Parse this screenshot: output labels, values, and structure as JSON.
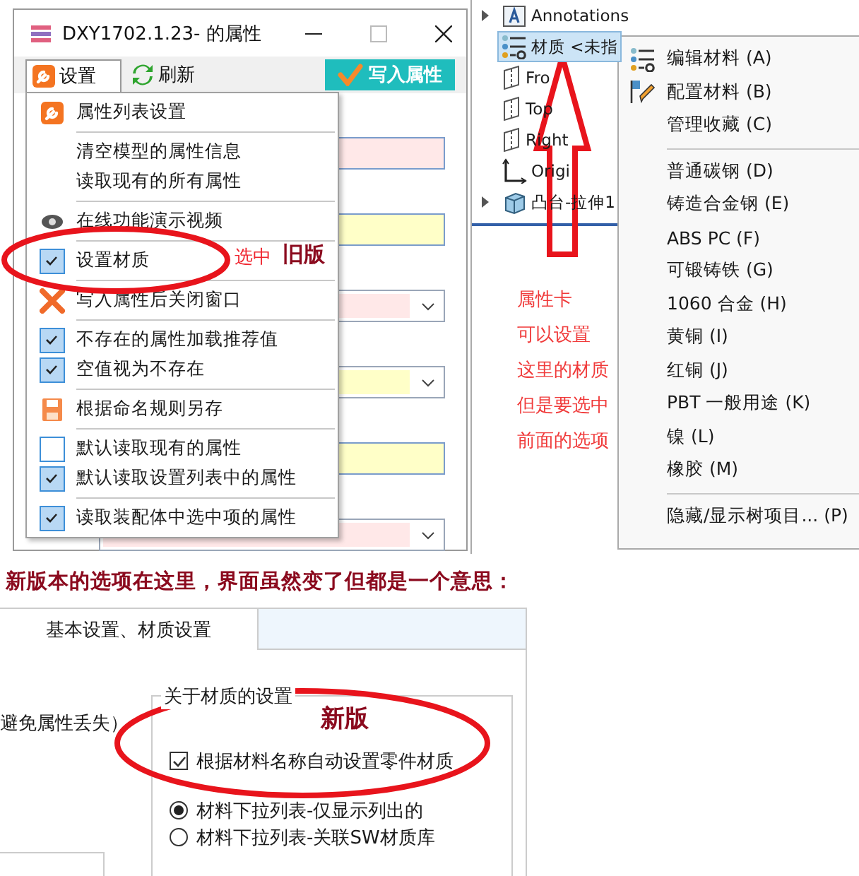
{
  "properties_window": {
    "title": "DXY1702.1.23-  的属性",
    "toolbar": [
      {
        "label": "设置",
        "kind": "settings",
        "selected": true
      },
      {
        "label": "刷新",
        "kind": "refresh",
        "selected": false
      },
      {
        "label": "写入属性",
        "kind": "write",
        "selected": false
      }
    ],
    "fields": [
      {
        "kind": "input",
        "color": "#ffe8e8"
      },
      {
        "kind": "input",
        "color": "#ffffc8"
      },
      {
        "kind": "select",
        "color": "#ffe8e8"
      },
      {
        "kind": "select",
        "color": "#ffffc8"
      },
      {
        "kind": "input",
        "color": "#ffffc8"
      },
      {
        "kind": "select",
        "color": "#ffe8e8"
      }
    ],
    "settings_menu": [
      {
        "kind": "settings",
        "label": "属性列表设置"
      },
      {
        "kind": "separator"
      },
      {
        "kind": "plain",
        "label": "清空模型的属性信息"
      },
      {
        "kind": "plain",
        "label": "读取现有的所有属性"
      },
      {
        "kind": "separator"
      },
      {
        "kind": "demo",
        "label": "在线功能演示视频"
      },
      {
        "kind": "separator"
      },
      {
        "kind": "check",
        "label": "设置材质",
        "checked": true
      },
      {
        "kind": "separator"
      },
      {
        "kind": "close",
        "label": "写入属性后关闭窗口"
      },
      {
        "kind": "separator"
      },
      {
        "kind": "check",
        "label": "不存在的属性加载推荐值",
        "checked": true
      },
      {
        "kind": "check",
        "label": "空值视为不存在",
        "checked": true
      },
      {
        "kind": "separator"
      },
      {
        "kind": "save",
        "label": "根据命名规则另存"
      },
      {
        "kind": "separator"
      },
      {
        "kind": "check",
        "label": "默认读取现有的属性",
        "checked": false
      },
      {
        "kind": "check",
        "label": "默认读取设置列表中的属性",
        "checked": true
      },
      {
        "kind": "separator"
      },
      {
        "kind": "check",
        "label": "读取装配体中选中项的属性",
        "checked": true
      }
    ]
  },
  "feature_tree": {
    "items": [
      {
        "kind": "annotations",
        "label": "Annotations",
        "expandable": true,
        "selected": false
      },
      {
        "kind": "material",
        "label": "材质 <未指",
        "expandable": false,
        "selected": true
      },
      {
        "kind": "plane",
        "label": "Fro",
        "expandable": false,
        "selected": false
      },
      {
        "kind": "plane",
        "label": "Top",
        "expandable": false,
        "selected": false
      },
      {
        "kind": "plane",
        "label": "Right",
        "expandable": false,
        "selected": false
      },
      {
        "kind": "origin",
        "label": "Origi",
        "expandable": false,
        "selected": false
      },
      {
        "kind": "feature",
        "label": "凸台-拉伸1",
        "expandable": true,
        "selected": false
      }
    ],
    "context_menu": [
      {
        "kind": "edit",
        "label": "编辑材料 (A)"
      },
      {
        "kind": "config",
        "label": "配置材料 (B)"
      },
      {
        "kind": "plain",
        "label": "管理收藏 (C)"
      },
      {
        "kind": "separator"
      },
      {
        "kind": "plain",
        "label": "普通碳钢 (D)"
      },
      {
        "kind": "plain",
        "label": "铸造合金钢 (E)"
      },
      {
        "kind": "plain",
        "label": "ABS PC (F)"
      },
      {
        "kind": "plain",
        "label": "可锻铸铁 (G)"
      },
      {
        "kind": "plain",
        "label": "1060 合金 (H)"
      },
      {
        "kind": "plain",
        "label": "黄铜 (I)"
      },
      {
        "kind": "plain",
        "label": "红铜 (J)"
      },
      {
        "kind": "plain",
        "label": "PBT 一般用途 (K)"
      },
      {
        "kind": "plain",
        "label": "镍 (L)"
      },
      {
        "kind": "plain",
        "label": "橡胶 (M)"
      },
      {
        "kind": "separator"
      },
      {
        "kind": "plain",
        "label": "隐藏/显示树项目... (P)"
      }
    ]
  },
  "new_settings_panel": {
    "tabs": [
      {
        "label": "基本设置、材质设置",
        "selected": true
      }
    ],
    "side_text": "避免属性丢失）",
    "group_title": "关于材质的设置",
    "options": [
      {
        "kind": "checkbox",
        "label": "根据材料名称自动设置零件材质",
        "checked": true
      },
      {
        "kind": "radio",
        "label": "材料下拉列表-仅显示列出的",
        "selected": true
      },
      {
        "kind": "radio",
        "label": "材料下拉列表-关联SW材质库",
        "selected": false
      }
    ]
  },
  "annotations": {
    "old_mark": "选中",
    "old_label": "旧版",
    "note_lines": [
      "属性卡",
      "可以设置",
      "这里的材质",
      "但是要选中",
      "前面的选项"
    ],
    "caption": "新版本的选项在这里，界面虽然变了但都是一个意思：",
    "new_label": "新版"
  }
}
